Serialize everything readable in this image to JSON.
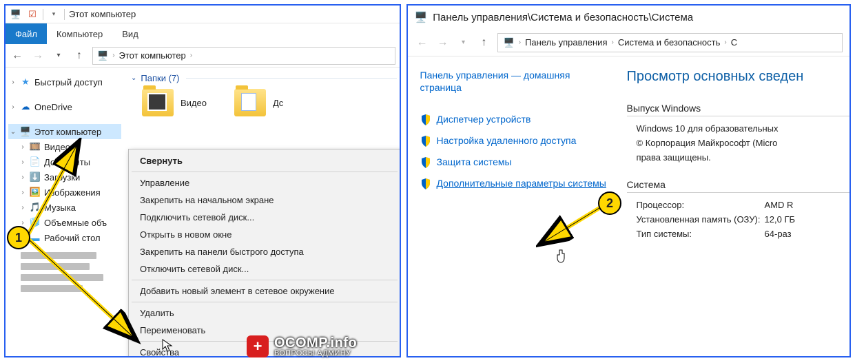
{
  "left": {
    "qat_title": "Этот компьютер",
    "ribbon": {
      "file": "Файл",
      "computer": "Компьютер",
      "view": "Вид"
    },
    "address": "Этот компьютер",
    "tree": {
      "quick": "Быстрый доступ",
      "onedrive": "OneDrive",
      "thispc": "Этот компьютер",
      "videos": "Видео",
      "documents": "Документы",
      "downloads": "Загрузки",
      "pictures": "Изображения",
      "music": "Музыка",
      "objects": "Объемные объ",
      "desktop": "Рабочий стол"
    },
    "group_header": "Папки (7)",
    "folder_video": "Видео",
    "folder_docs_trunc": "Дс",
    "ctx": {
      "collapse": "Свернуть",
      "manage": "Управление",
      "pin_start": "Закрепить на начальном экране",
      "map_net": "Подключить сетевой диск...",
      "open_new": "Открыть в новом окне",
      "pin_qa": "Закрепить на панели быстрого доступа",
      "disc_net": "Отключить сетевой диск...",
      "add_net": "Добавить новый элемент в сетевое окружение",
      "delete": "Удалить",
      "rename": "Переименовать",
      "properties": "Свойства"
    }
  },
  "right": {
    "header": "Панель управления\\Система и безопасность\\Система",
    "crumb1": "Панель управления",
    "crumb2": "Система и безопасность",
    "crumb3": "С",
    "home": "Панель управления — домашняя страница",
    "links": {
      "devmgr": "Диспетчер устройств",
      "remote": "Настройка удаленного доступа",
      "sysprot": "Защита системы",
      "advanced": "Дополнительные параметры системы"
    },
    "title": "Просмотр основных сведен",
    "sect_edition": "Выпуск Windows",
    "edition_value": "Windows 10 для образовательных",
    "copyright": "© Корпорация Майкрософт (Micro",
    "rights": "права защищены.",
    "sect_system": "Система",
    "cpu_k": "Процессор:",
    "cpu_v": "AMD R",
    "ram_k": "Установленная память (ОЗУ):",
    "ram_v": "12,0 ГБ",
    "type_k": "Тип системы:",
    "type_v": "64-раз"
  },
  "annot": {
    "one": "1",
    "two": "2"
  },
  "watermark": {
    "main": "OCOMP.info",
    "sub": "ВОПРОСЫ АДМИНУ"
  }
}
